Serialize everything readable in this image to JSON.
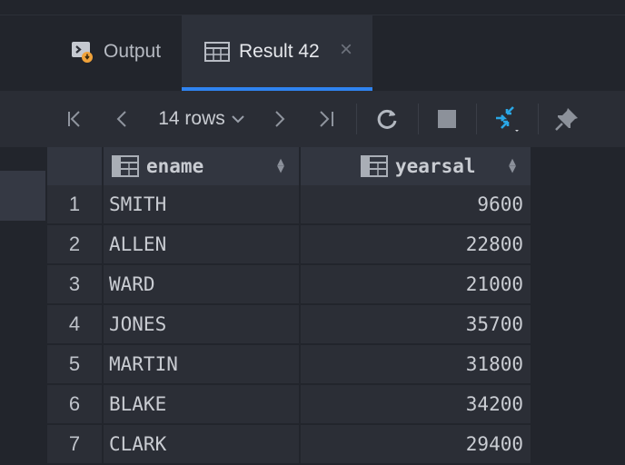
{
  "tabs": [
    {
      "label": "Output",
      "icon": "output-icon"
    },
    {
      "label": "Result 42",
      "icon": "table-grid-icon",
      "active": true
    }
  ],
  "toolbar": {
    "rows_label": "14 rows",
    "icons": [
      "first-page-icon",
      "prev-page-icon",
      "chevron-down-icon",
      "next-page-icon",
      "last-page-icon",
      "refresh-icon",
      "stop-icon",
      "compare-arrows-icon",
      "pin-icon"
    ]
  },
  "table": {
    "columns": [
      {
        "label": "ename",
        "icon": "column-icon"
      },
      {
        "label": "yearsal",
        "icon": "column-icon"
      }
    ],
    "rows": [
      {
        "num": "1",
        "ename": "SMITH",
        "yearsal": "9600"
      },
      {
        "num": "2",
        "ename": "ALLEN",
        "yearsal": "22800"
      },
      {
        "num": "3",
        "ename": "WARD",
        "yearsal": "21000"
      },
      {
        "num": "4",
        "ename": "JONES",
        "yearsal": "35700"
      },
      {
        "num": "5",
        "ename": "MARTIN",
        "yearsal": "31800"
      },
      {
        "num": "6",
        "ename": "BLAKE",
        "yearsal": "34200"
      },
      {
        "num": "7",
        "ename": "CLARK",
        "yearsal": "29400"
      }
    ]
  },
  "colors": {
    "accent": "#2f83f0",
    "compare_icon": "#2aa7e6",
    "warn": "#f0a23a"
  }
}
